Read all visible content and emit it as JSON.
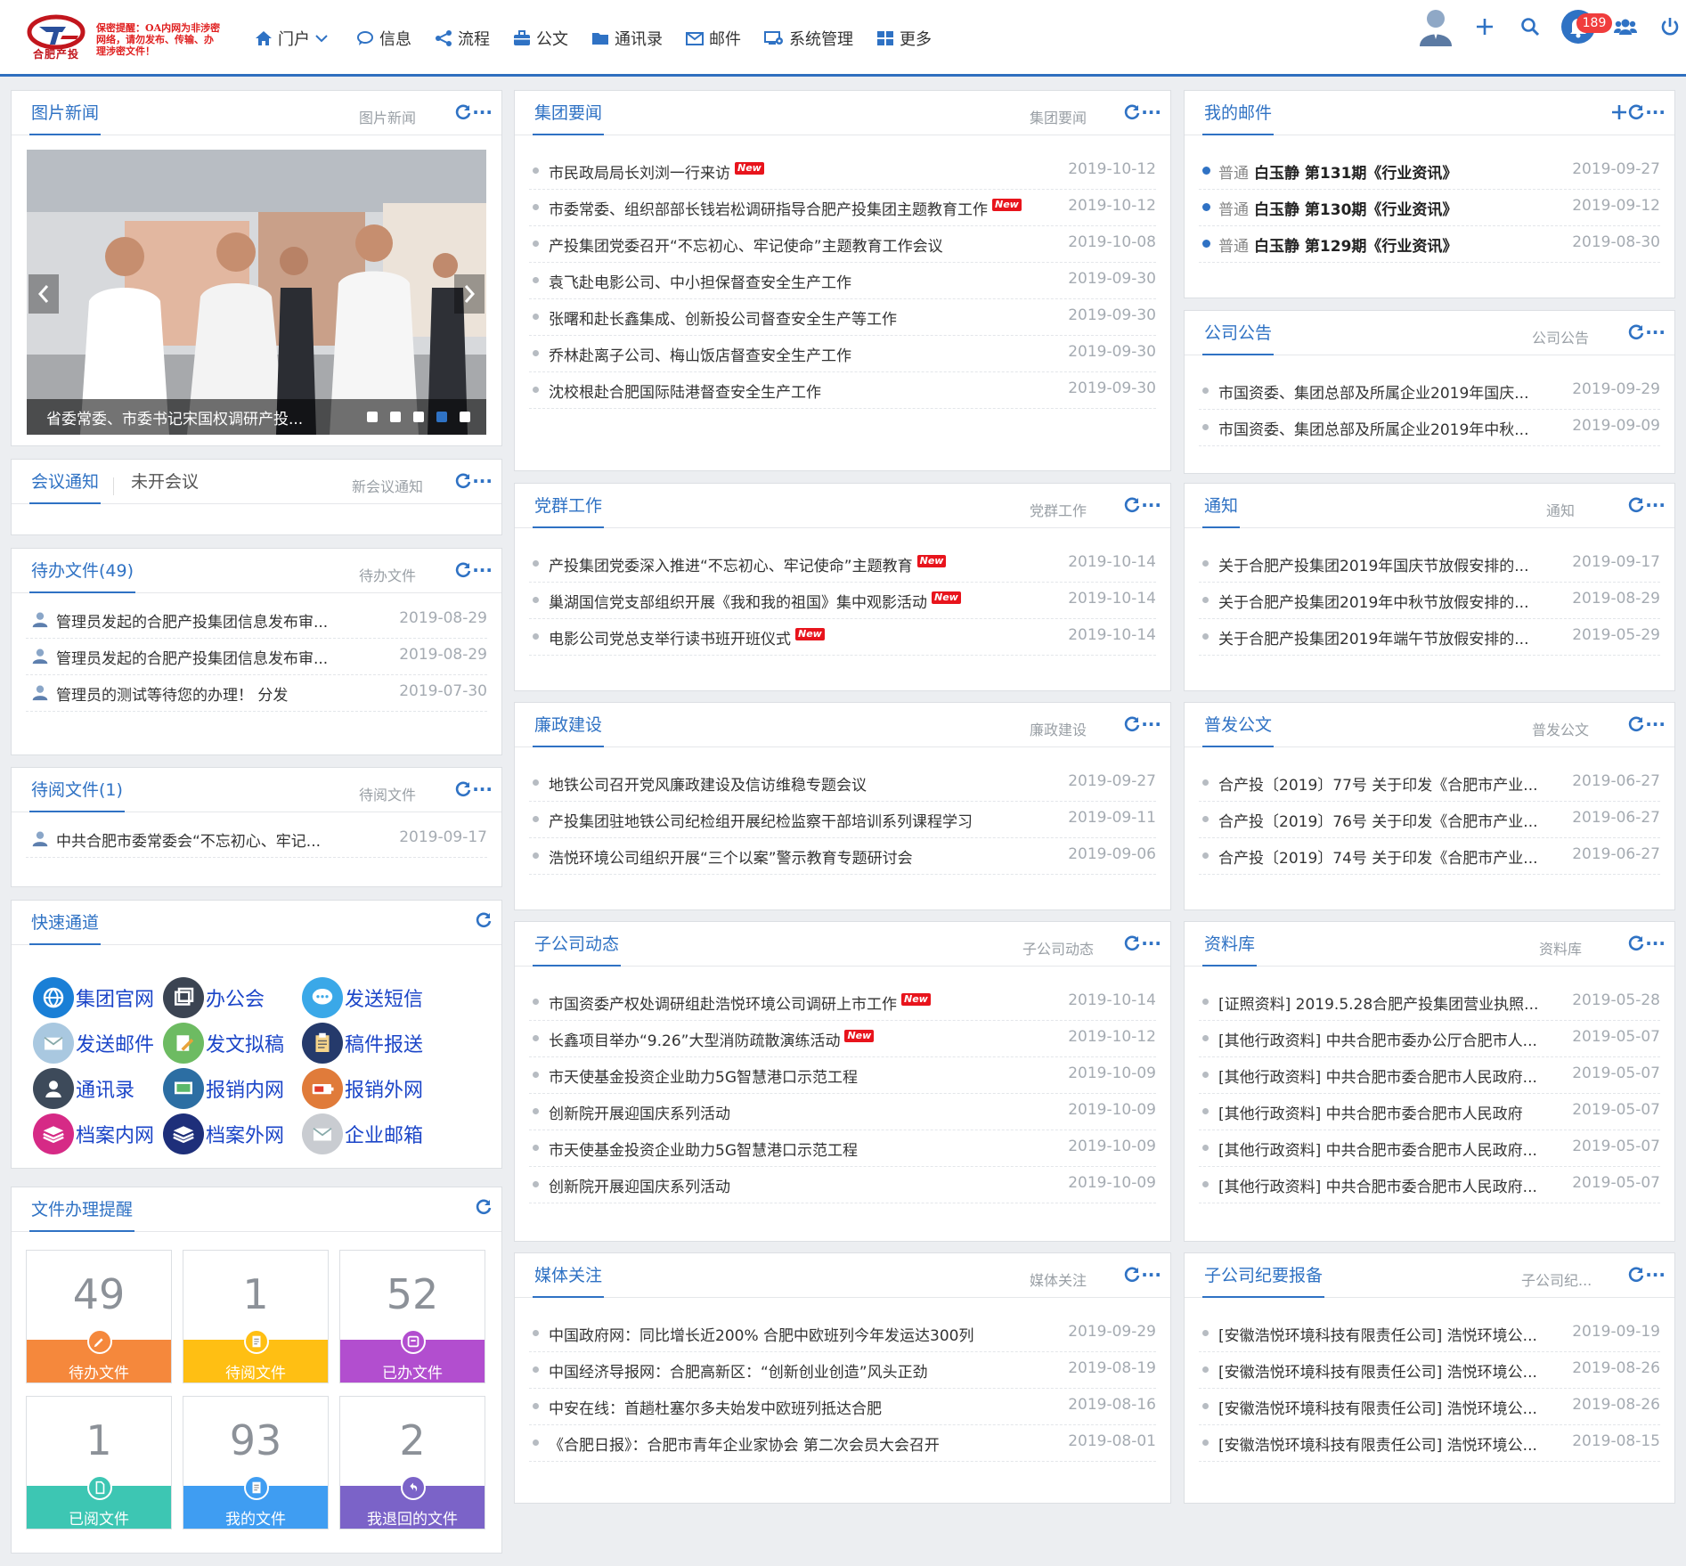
{
  "header": {
    "logo_text": "合肥产投",
    "secrecy": "保密提醒：OA内网为非涉密网络，请勿发布、传输、办理涉密文件！",
    "nav": [
      {
        "label": "门户"
      },
      {
        "label": "信息"
      },
      {
        "label": "流程"
      },
      {
        "label": "公文"
      },
      {
        "label": "通讯录"
      },
      {
        "label": "邮件"
      },
      {
        "label": "系统管理"
      },
      {
        "label": "更多"
      }
    ],
    "notification_count": "189"
  },
  "more_icon": "···",
  "new_badge": "New",
  "picture_news": {
    "title": "图片新闻",
    "sub": "图片新闻",
    "caption": "省委常委、市委书记宋国权调研产投...",
    "slides": 5,
    "active_slide": 4
  },
  "meeting": {
    "title": "会议通知",
    "tab2": "未开会议",
    "sub": "新会议通知"
  },
  "pending_docs": {
    "title": "待办文件(49)",
    "sub": "待办文件",
    "items": [
      {
        "text": "管理员发起的合肥产投集团信息发布审...",
        "date": "2019-08-29"
      },
      {
        "text": "管理员发起的合肥产投集团信息发布审...",
        "date": "2019-08-29"
      },
      {
        "text": "管理员的测试等待您的办理！ 分发",
        "date": "2019-07-30"
      }
    ]
  },
  "pending_read": {
    "title": "待阅文件(1)",
    "sub": "待阅文件",
    "items": [
      {
        "text": "中共合肥市委常委会“不忘初心、牢记...",
        "date": "2019-09-17"
      }
    ]
  },
  "quick": {
    "title": "快速通道",
    "links": [
      {
        "label": "集团官网",
        "icon": "globe-icon",
        "color": "#1a7fd6"
      },
      {
        "label": "办公会",
        "icon": "windows-icon",
        "color": "#3b4452"
      },
      {
        "label": "发送短信",
        "icon": "chat-icon",
        "color": "#3aa8e8"
      },
      {
        "label": "发送邮件",
        "icon": "mail-icon",
        "color": "#a9c8e0"
      },
      {
        "label": "发文拟稿",
        "icon": "pen-icon",
        "color": "#6dbb62"
      },
      {
        "label": "稿件报送",
        "icon": "clipboard-icon",
        "color": "#253a6b"
      },
      {
        "label": "通讯录",
        "icon": "user-icon",
        "color": "#3d4a5a"
      },
      {
        "label": "报销内网",
        "icon": "monitor-icon",
        "color": "#2c6ea3"
      },
      {
        "label": "报销外网",
        "icon": "battery-icon",
        "color": "#e07b3a"
      },
      {
        "label": "档案内网",
        "icon": "layers-icon",
        "color": "#d62a86"
      },
      {
        "label": "档案外网",
        "icon": "layers-icon",
        "color": "#1e2f7a"
      },
      {
        "label": "企业邮箱",
        "icon": "mail-icon",
        "color": "#c9ccd1"
      }
    ]
  },
  "reminder": {
    "title": "文件办理提醒",
    "tiles": [
      {
        "num": "49",
        "label": "待办文件",
        "color": "#f5883c",
        "icon": "pencil-icon"
      },
      {
        "num": "1",
        "label": "待阅文件",
        "color": "#ffbf13",
        "icon": "doc-icon"
      },
      {
        "num": "52",
        "label": "已办文件",
        "color": "#b24ecf",
        "icon": "archive-icon"
      },
      {
        "num": "1",
        "label": "已阅文件",
        "color": "#3dc6b3",
        "icon": "file-icon"
      },
      {
        "num": "93",
        "label": "我的文件",
        "color": "#3f9df2",
        "icon": "doc-icon"
      },
      {
        "num": "2",
        "label": "我退回的文件",
        "color": "#7b63c8",
        "icon": "undo-icon"
      }
    ]
  },
  "group_news": {
    "title": "集团要闻",
    "sub": "集团要闻",
    "items": [
      {
        "text": "市民政局局长刘浏一行来访",
        "date": "2019-10-12",
        "new": true
      },
      {
        "text": "市委常委、组织部部长钱岩松调研指导合肥产投集团主题教育工作",
        "date": "2019-10-12",
        "new": true
      },
      {
        "text": "产投集团党委召开“不忘初心、牢记使命”主题教育工作会议",
        "date": "2019-10-08",
        "new": false
      },
      {
        "text": "袁飞赴电影公司、中小担保督查安全生产工作",
        "date": "2019-09-30",
        "new": false
      },
      {
        "text": "张曙和赴长鑫集成、创新投公司督查安全生产等工作",
        "date": "2019-09-30",
        "new": false
      },
      {
        "text": "乔林赴离子公司、梅山饭店督查安全生产工作",
        "date": "2019-09-30",
        "new": false
      },
      {
        "text": "沈校根赴合肥国际陆港督查安全生产工作",
        "date": "2019-09-30",
        "new": false
      }
    ]
  },
  "party_work": {
    "title": "党群工作",
    "sub": "党群工作",
    "items": [
      {
        "text": "产投集团党委深入推进“不忘初心、牢记使命”主题教育",
        "date": "2019-10-14",
        "new": true
      },
      {
        "text": "巢湖国信党支部组织开展《我和我的祖国》集中观影活动",
        "date": "2019-10-14",
        "new": true
      },
      {
        "text": "电影公司党总支举行读书班开班仪式",
        "date": "2019-10-14",
        "new": true
      }
    ]
  },
  "integrity": {
    "title": "廉政建设",
    "sub": "廉政建设",
    "items": [
      {
        "text": "地铁公司召开党风廉政建设及信访维稳专题会议",
        "date": "2019-09-27"
      },
      {
        "text": "产投集团驻地铁公司纪检组开展纪检监察干部培训系列课程学习",
        "date": "2019-09-11"
      },
      {
        "text": "浩悦环境公司组织开展“三个以案”警示教育专题研讨会",
        "date": "2019-09-06"
      }
    ]
  },
  "subsidiary": {
    "title": "子公司动态",
    "sub": "子公司动态",
    "items": [
      {
        "text": "市国资委产权处调研组赴浩悦环境公司调研上市工作",
        "date": "2019-10-14",
        "new": true
      },
      {
        "text": "长鑫项目举办“9.26”大型消防疏散演练活动",
        "date": "2019-10-12",
        "new": true
      },
      {
        "text": "市天使基金投资企业助力5G智慧港口示范工程",
        "date": "2019-10-09",
        "new": false
      },
      {
        "text": "创新院开展迎国庆系列活动",
        "date": "2019-10-09",
        "new": false
      },
      {
        "text": "市天使基金投资企业助力5G智慧港口示范工程",
        "date": "2019-10-09",
        "new": false
      },
      {
        "text": "创新院开展迎国庆系列活动",
        "date": "2019-10-09",
        "new": false
      }
    ]
  },
  "media": {
    "title": "媒体关注",
    "sub": "媒体关注",
    "items": [
      {
        "text": "中国政府网：同比增长近200% 合肥中欧班列今年发运达300列",
        "date": "2019-09-29"
      },
      {
        "text": "中国经济导报网：合肥高新区：“创新创业创造”风头正劲",
        "date": "2019-08-19"
      },
      {
        "text": "中安在线：首趟杜塞尔多夫始发中欧班列抵达合肥",
        "date": "2019-08-16"
      },
      {
        "text": "《合肥日报》：合肥市青年企业家协会 第二次会员大会召开",
        "date": "2019-08-01"
      }
    ]
  },
  "mail": {
    "title": "我的邮件",
    "items": [
      {
        "tag": "普通",
        "text": "白玉静 第131期《行业资讯》",
        "date": "2019-09-27"
      },
      {
        "tag": "普通",
        "text": "白玉静 第130期《行业资讯》",
        "date": "2019-09-12"
      },
      {
        "tag": "普通",
        "text": "白玉静 第129期《行业资讯》",
        "date": "2019-08-30"
      }
    ]
  },
  "announce": {
    "title": "公司公告",
    "sub": "公司公告",
    "items": [
      {
        "text": "市国资委、集团总部及所属企业2019年国庆...",
        "date": "2019-09-29"
      },
      {
        "text": "市国资委、集团总部及所属企业2019年中秋...",
        "date": "2019-09-09"
      }
    ]
  },
  "notice": {
    "title": "通知",
    "sub": "通知",
    "items": [
      {
        "text": "关于合肥产投集团2019年国庆节放假安排的...",
        "date": "2019-09-17"
      },
      {
        "text": "关于合肥产投集团2019年中秋节放假安排的...",
        "date": "2019-08-29"
      },
      {
        "text": "关于合肥产投集团2019年端午节放假安排的...",
        "date": "2019-05-29"
      }
    ]
  },
  "general_docs": {
    "title": "普发公文",
    "sub": "普发公文",
    "items": [
      {
        "text": "合产投〔2019〕77号 关于印发《合肥市产业...",
        "date": "2019-06-27"
      },
      {
        "text": "合产投〔2019〕76号 关于印发《合肥市产业...",
        "date": "2019-06-27"
      },
      {
        "text": "合产投〔2019〕74号 关于印发《合肥市产业...",
        "date": "2019-06-27"
      }
    ]
  },
  "library": {
    "title": "资料库",
    "sub": "资料库",
    "items": [
      {
        "text": "[证照资料] 2019.5.28合肥产投集团营业执照...",
        "date": "2019-05-28"
      },
      {
        "text": "[其他行政资料] 中共合肥市委办公厅合肥市人...",
        "date": "2019-05-07"
      },
      {
        "text": "[其他行政资料] 中共合肥市委合肥市人民政府...",
        "date": "2019-05-07"
      },
      {
        "text": "[其他行政资料] 中共合肥市委合肥市人民政府",
        "date": "2019-05-07"
      },
      {
        "text": "[其他行政资料] 中共合肥市委合肥市人民政府...",
        "date": "2019-05-07"
      },
      {
        "text": "[其他行政资料] 中共合肥市委合肥市人民政府...",
        "date": "2019-05-07"
      }
    ]
  },
  "discipline": {
    "title": "子公司纪要报备",
    "sub": "子公司纪...",
    "items": [
      {
        "text": "[安徽浩悦环境科技有限责任公司] 浩悦环境公...",
        "date": "2019-09-19"
      },
      {
        "text": "[安徽浩悦环境科技有限责任公司] 浩悦环境公...",
        "date": "2019-08-26"
      },
      {
        "text": "[安徽浩悦环境科技有限责任公司] 浩悦环境公...",
        "date": "2019-08-26"
      },
      {
        "text": "[安徽浩悦环境科技有限责任公司] 浩悦环境公...",
        "date": "2019-08-15"
      }
    ]
  }
}
